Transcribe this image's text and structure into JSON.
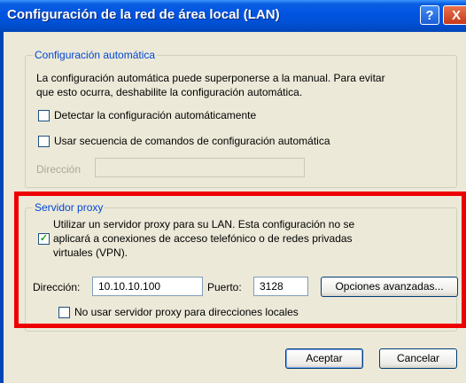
{
  "window": {
    "title": "Configuración de la red de área local (LAN)",
    "help_label": "?",
    "close_label": "X"
  },
  "auto_config": {
    "legend": "Configuración automática",
    "description_line1": "La configuración automática puede superponerse a la manual. Para evitar",
    "description_line2": "que esto ocurra, deshabilite la configuración automática.",
    "detect_label": "Detectar la configuración automáticamente",
    "detect_checked": false,
    "script_label": "Usar secuencia de comandos de configuración automática",
    "script_checked": false,
    "address_label": "Dirección",
    "address_value": ""
  },
  "proxy": {
    "legend": "Servidor proxy",
    "use_proxy_line1": "Utilizar un servidor proxy para su LAN. Esta configuración no se",
    "use_proxy_line2": "aplicará a conexiones de acceso telefónico o de redes privadas",
    "use_proxy_line3": "virtuales (VPN).",
    "use_proxy_checked": true,
    "check_glyph": "✓",
    "address_label": "Dirección:",
    "address_value": "10.10.10.100",
    "port_label": "Puerto:",
    "port_value": "3128",
    "advanced_label": "Opciones avanzadas...",
    "bypass_label": "No usar servidor proxy para direcciones locales",
    "bypass_checked": false
  },
  "footer": {
    "ok_label": "Aceptar",
    "cancel_label": "Cancelar"
  },
  "colors": {
    "title_bar": "#0054e3",
    "legend_text": "#0046d5",
    "highlight": "#ee0000",
    "check": "#21a121"
  }
}
